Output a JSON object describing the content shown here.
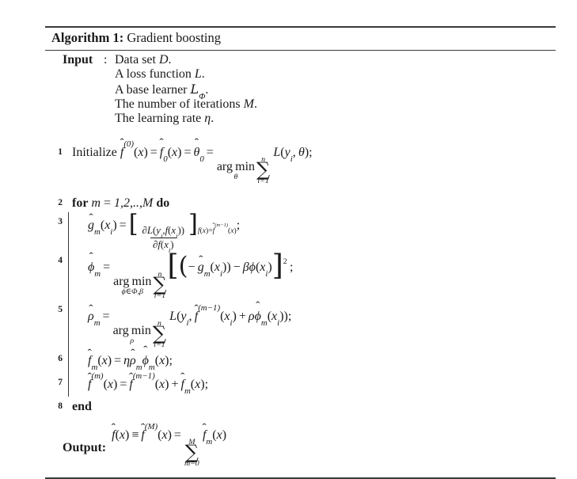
{
  "document": {
    "type": "algorithm-pseudocode",
    "background_color": "#ffffff",
    "rule_color": "#3a3a3a",
    "text_color": "#1a1a1a"
  },
  "caption": {
    "keyword": "Algorithm 1:",
    "title": "Gradient boosting"
  },
  "input_block": {
    "label": "Input",
    "colon": ":",
    "items": [
      {
        "text_prefix": "Data set ",
        "symbol": "D",
        "suffix": "."
      },
      {
        "text_prefix": "A loss function ",
        "symbol": "L",
        "suffix": "."
      },
      {
        "text_prefix": "A base learner ",
        "symbol": "L",
        "subscript": "Φ",
        "suffix": "."
      },
      {
        "text_prefix": "The number of iterations ",
        "symbol": "M",
        "suffix": "."
      },
      {
        "text_prefix": "The learning rate ",
        "symbol": "η",
        "suffix": "."
      }
    ]
  },
  "lines": [
    {
      "number": "1",
      "kind": "statement",
      "keyword": "Initialize",
      "formula_plain": "f̂^(0)(x) = f̂_0(x) = θ̂_0 = arg min_θ ∑_{i=1}^{n} L(y_i, θ);"
    },
    {
      "number": "2",
      "kind": "for",
      "keyword_for": "for",
      "iterator": "m",
      "equals": "=",
      "range": "1,2,..,M",
      "keyword_do": "do"
    },
    {
      "number": "3",
      "kind": "body",
      "formula_plain": "ĝ_m(x_i) = [ ∂L(y_i, f(x_i)) / ∂f(x_i) ]_{f(x)=f̂^(m-1)(x)} ;"
    },
    {
      "number": "4",
      "kind": "body",
      "formula_plain": "ϕ̂_m = arg min_{ϕ∈Φ,β} ∑_{i=1}^{n} [ ( - ĝ_m(x_i) ) - βϕ(x_i) ]^2 ;"
    },
    {
      "number": "5",
      "kind": "body",
      "formula_plain": "ρ̂_m = arg min_ρ ∑_{i=1}^{n} L(y_i, f̂^(m-1)(x_i) + ρϕ̂_m(x_i));"
    },
    {
      "number": "6",
      "kind": "body",
      "formula_plain": "f̂_m(x) = η ρ̂_m ϕ̂_m(x);"
    },
    {
      "number": "7",
      "kind": "body",
      "formula_plain": "f̂^(m)(x) = f̂^(m-1)(x) + f̂_m(x);"
    },
    {
      "number": "8",
      "kind": "end",
      "keyword": "end"
    }
  ],
  "output_block": {
    "label": "Output:",
    "formula_plain": "f̂(x) ≡ f̂^(M)(x) = ∑_{m=0}^{M} f̂_m(x)"
  },
  "symbols": {
    "hat": "̂",
    "sum": "∑",
    "partial": "∂",
    "theta": "θ",
    "eta": "η",
    "rho": "ρ",
    "beta": "β",
    "phi_small": "ϕ",
    "Phi": "Φ",
    "equiv": "≡",
    "elem": "∈",
    "minus": "−",
    "arg": "arg",
    "min": "min",
    "circumflex": "̂"
  }
}
